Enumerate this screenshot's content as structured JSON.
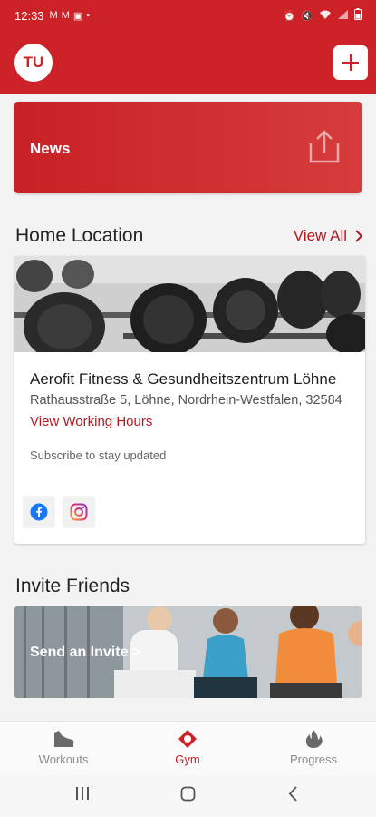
{
  "status_bar": {
    "time": "12:33",
    "left_icons": [
      "gmail-icon",
      "gmail-icon",
      "image-icon",
      "dot-icon"
    ],
    "right_icons": [
      "alarm-icon",
      "mute-icon",
      "wifi-icon",
      "signal-icon",
      "battery-icon"
    ]
  },
  "app_bar": {
    "avatar_initials": "TU",
    "add_icon": "plus-icon",
    "accent": "#cc2127"
  },
  "news_banner": {
    "label": "News",
    "icon": "share-icon"
  },
  "home_location": {
    "title": "Home Location",
    "view_all": "View All",
    "gym": {
      "name": "Aerofit Fitness & Gesundheitszentrum Löhne",
      "address": "Rathausstraße 5, Löhne, Nordrhein-Westfalen, 32584",
      "hours_link": "View Working Hours",
      "subscribe_text": "Subscribe to stay updated",
      "socials": [
        "facebook-icon",
        "instagram-icon"
      ]
    }
  },
  "invite_friends": {
    "title": "Invite Friends",
    "cta": "Send an Invite >"
  },
  "bottom_nav": {
    "items": [
      {
        "label": "Workouts",
        "icon": "sneaker-icon",
        "active": false
      },
      {
        "label": "Gym",
        "icon": "location-pin-icon",
        "active": true
      },
      {
        "label": "Progress",
        "icon": "flame-icon",
        "active": false
      }
    ]
  },
  "system_nav": [
    "recents-icon",
    "home-icon",
    "back-icon"
  ]
}
